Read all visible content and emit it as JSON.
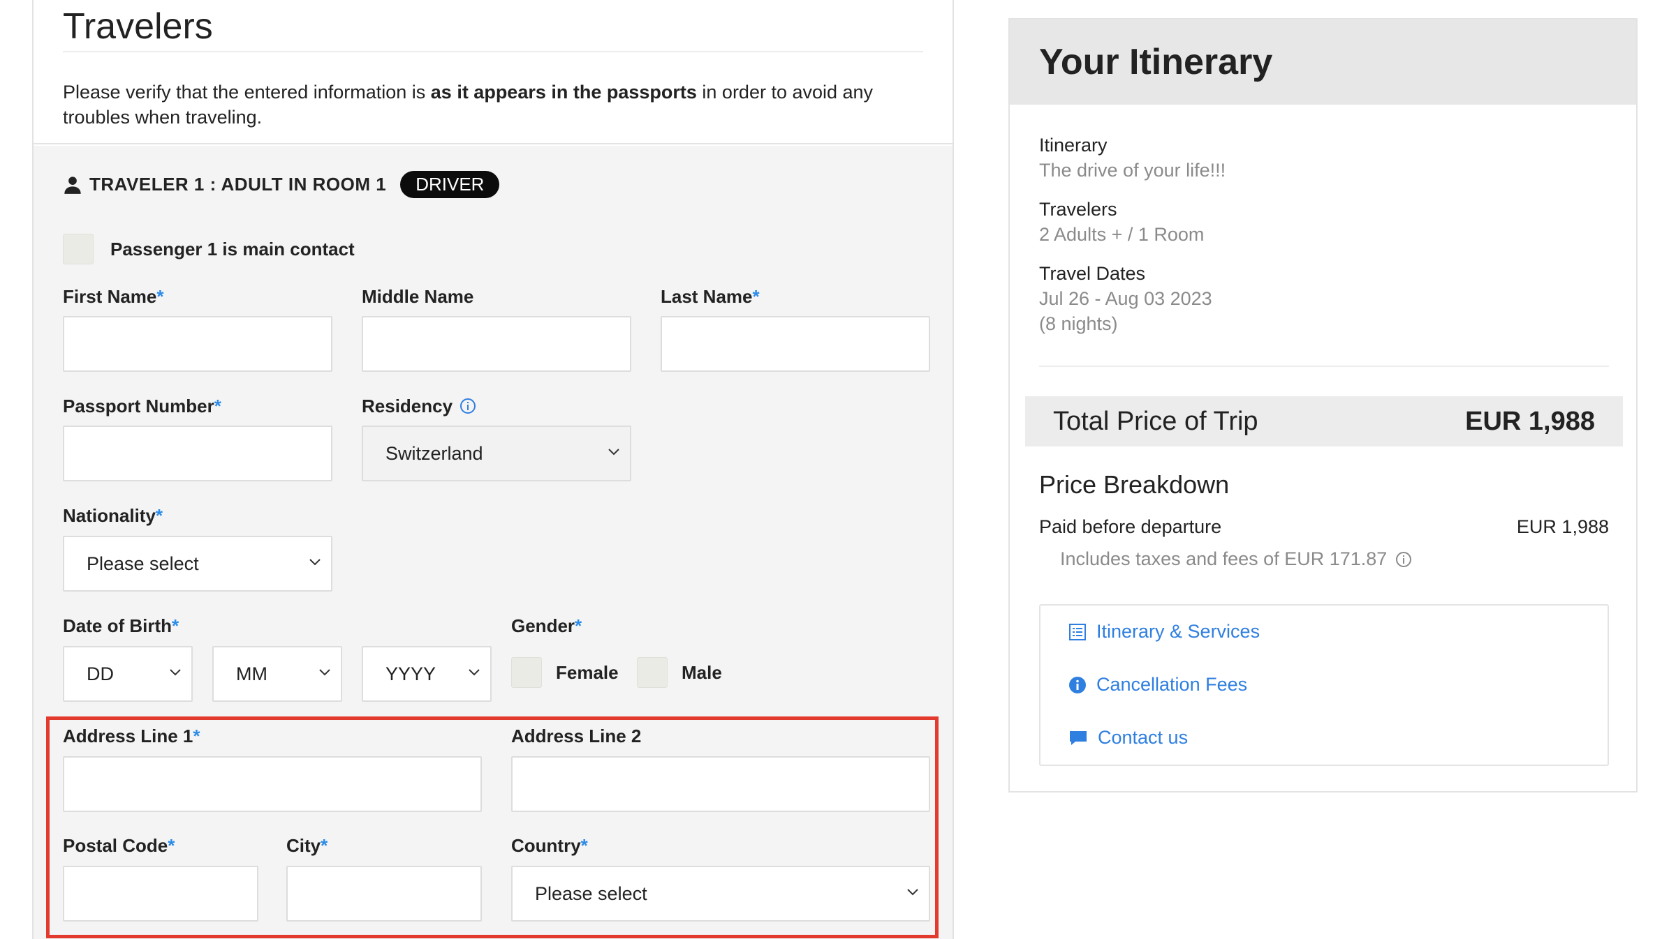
{
  "travelers_section": {
    "title": "Travelers",
    "intro_prefix": "Please verify that the entered information is ",
    "intro_bold": "as it appears in the passports",
    "intro_suffix": " in order to avoid any troubles when traveling."
  },
  "traveler1": {
    "heading": "TRAVELER 1 : ADULT IN ROOM 1",
    "badge": "DRIVER",
    "main_contact_label": "Passenger 1 is main contact",
    "first_name_label": "First Name",
    "middle_name_label": "Middle Name",
    "last_name_label": "Last Name",
    "passport_label": "Passport Number",
    "residency_label": "Residency",
    "residency_value": "Switzerland",
    "nationality_label": "Nationality",
    "nationality_value": "Please select",
    "dob_label": "Date of Birth",
    "dob_day": "DD",
    "dob_month": "MM",
    "dob_year": "YYYY",
    "gender_label": "Gender",
    "gender_female": "Female",
    "gender_male": "Male",
    "address1_label": "Address Line 1",
    "address2_label": "Address Line 2",
    "postal_label": "Postal Code",
    "city_label": "City",
    "country_label": "Country",
    "country_value": "Please select",
    "required_mark": "*"
  },
  "itinerary": {
    "title": "Your Itinerary",
    "itinerary_label": "Itinerary",
    "itinerary_value": "The drive of your life!!!",
    "travelers_label": "Travelers",
    "travelers_value": "2 Adults + / 1 Room",
    "dates_label": "Travel Dates",
    "dates_value": "Jul 26 - Aug 03 2023",
    "nights_value": "(8 nights)",
    "total_label": "Total Price of Trip",
    "total_value": "EUR 1,988",
    "breakdown_title": "Price Breakdown",
    "paid_label": "Paid before departure",
    "paid_value": "EUR 1,988",
    "taxes_text": "Includes taxes and fees of EUR 171.87",
    "links": {
      "services": "Itinerary & Services",
      "cancellation": "Cancellation Fees",
      "contact": "Contact us"
    }
  },
  "colors": {
    "required": "#2b8be8",
    "link": "#2f7fe0",
    "highlight_border": "#e23b2e",
    "badge_bg": "#0c0c0c"
  }
}
